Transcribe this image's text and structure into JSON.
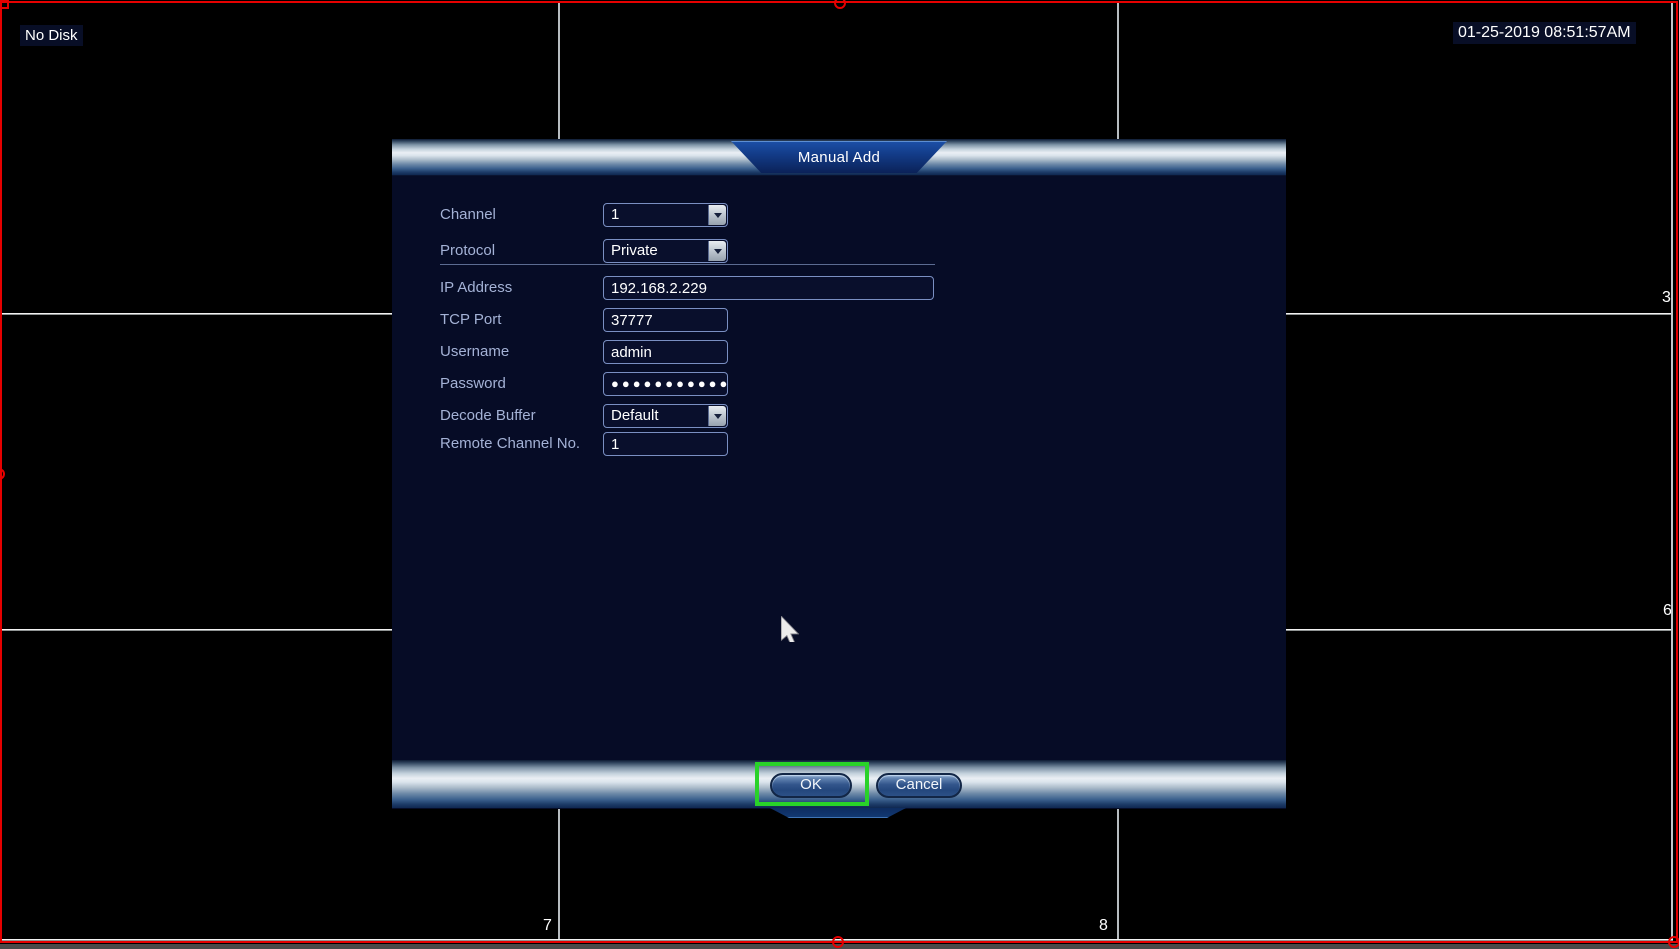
{
  "screen": {
    "status_text": "No Disk",
    "timestamp": "01-25-2019 08:51:57AM",
    "cell_numbers": [
      "3",
      "6",
      "7",
      "8"
    ]
  },
  "dialog": {
    "title": "Manual Add",
    "fields": [
      {
        "label": "Channel",
        "value": "1",
        "control": "dropdown"
      },
      {
        "label": "Protocol",
        "value": "Private",
        "control": "dropdown"
      },
      {
        "label": "IP Address",
        "value": "192.168.2.229",
        "control": "text"
      },
      {
        "label": "TCP Port",
        "value": "37777",
        "control": "text"
      },
      {
        "label": "Username",
        "value": "admin",
        "control": "text"
      },
      {
        "label": "Password",
        "value": "●●●●●●●●●●●",
        "control": "password"
      },
      {
        "label": "Decode Buffer",
        "value": "Default",
        "control": "dropdown"
      },
      {
        "label": "Remote Channel No.",
        "value": "1",
        "control": "text"
      }
    ],
    "buttons": {
      "ok": "OK",
      "cancel": "Cancel"
    }
  },
  "annotations": {
    "ok_highlight_color": "#29d229",
    "border_color": "#e60000"
  }
}
